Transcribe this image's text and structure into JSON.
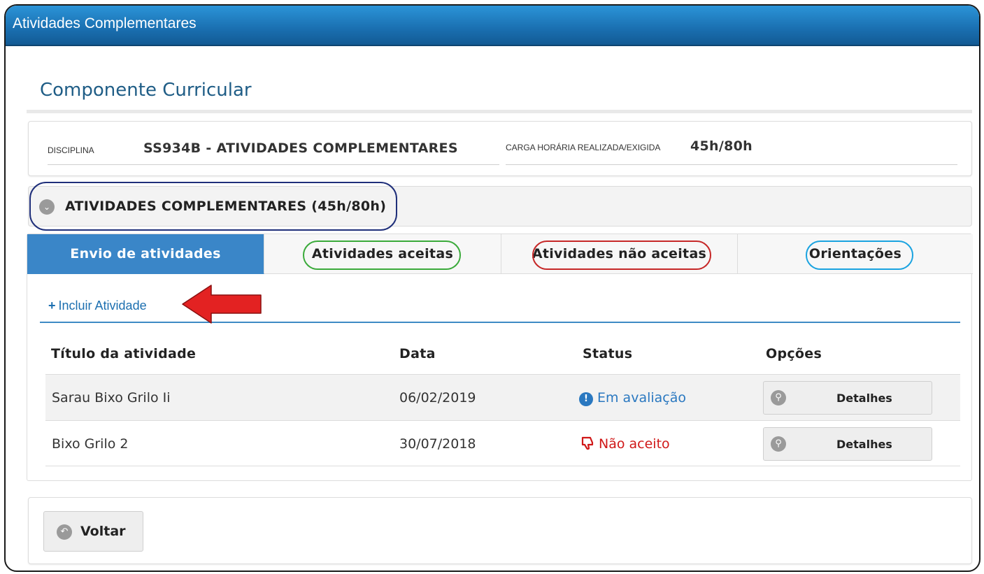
{
  "window": {
    "title": "Atividades Complementares"
  },
  "page": {
    "title": "Componente Curricular"
  },
  "info": {
    "disciplina_label": "DISCIPLINA",
    "disciplina_value": "SS934B - ATIVIDADES COMPLEMENTARES",
    "carga_label": "CARGA HORÁRIA REALIZADA/EXIGIDA",
    "carga_value": "45h/80h"
  },
  "accordion": {
    "title": "ATIVIDADES COMPLEMENTARES (45h/80h)",
    "icon": "chevron-down-icon"
  },
  "tabs": [
    {
      "label": "Envio de atividades",
      "active": true
    },
    {
      "label": "Atividades aceitas",
      "active": false
    },
    {
      "label": "Atividades não aceitas",
      "active": false
    },
    {
      "label": "Orientações",
      "active": false
    }
  ],
  "include": {
    "plus": "+",
    "label": "Incluir Atividade"
  },
  "table": {
    "headers": [
      "Título da atividade",
      "Data",
      "Status",
      "Opções"
    ],
    "rows": [
      {
        "title": "Sarau Bixo Grilo Ii",
        "date": "06/02/2019",
        "status_icon": "!",
        "status": "Em avaliação",
        "action": "Detalhes"
      },
      {
        "title": "Bixo Grilo 2",
        "date": "30/07/2018",
        "status_icon": "thumbs-down",
        "status": "Não aceito",
        "action": "Detalhes"
      }
    ]
  },
  "footer": {
    "back_label": "Voltar"
  },
  "colors": {
    "titlebar": "#1a6fb0",
    "active_tab": "#3a86c8",
    "link": "#1c6fb0",
    "status_eval": "#2a78c0",
    "status_rejected": "#d01818",
    "highlight_navy": "#1f2f7a",
    "highlight_green": "#3aaa3a",
    "highlight_red": "#c62828",
    "highlight_cyan": "#1aa3e0",
    "arrow": "#e32222"
  }
}
